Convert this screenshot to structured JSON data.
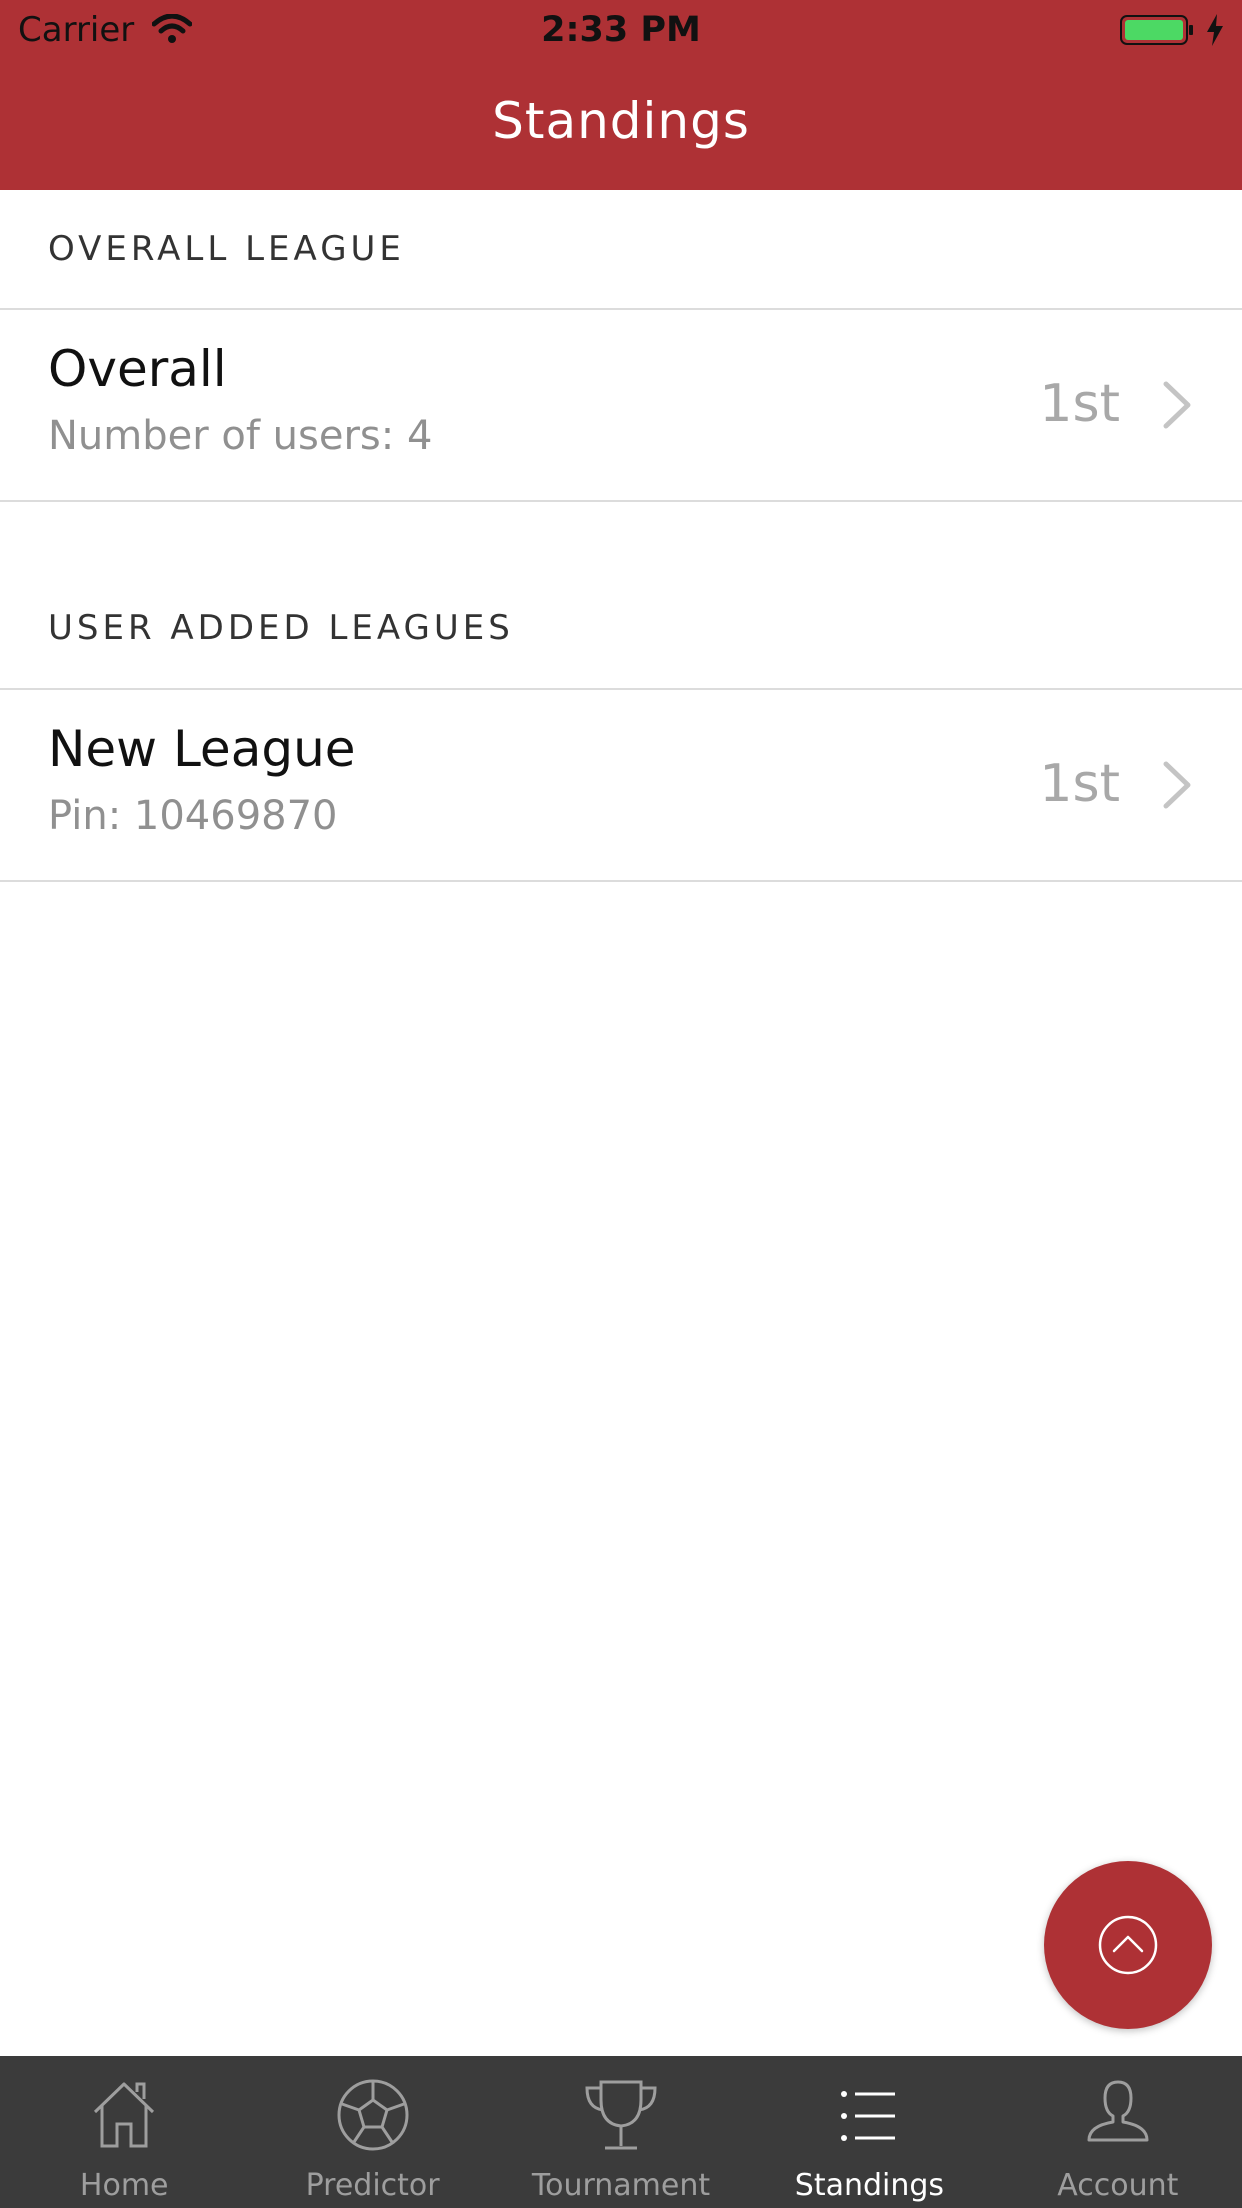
{
  "status_bar": {
    "carrier": "Carrier",
    "time": "2:33 PM"
  },
  "header": {
    "title": "Standings"
  },
  "sections": {
    "overall": {
      "title": "OVERALL LEAGUE",
      "rows": [
        {
          "name": "Overall",
          "subtitle": "Number of users: 4",
          "rank": "1st"
        }
      ]
    },
    "user_added": {
      "title": "USER ADDED LEAGUES",
      "rows": [
        {
          "name": "New League",
          "subtitle": "Pin: 10469870",
          "rank": "1st"
        }
      ]
    }
  },
  "fab": {
    "icon": "chevron-up-circle-icon"
  },
  "tabbar": {
    "tabs": [
      {
        "label": "Home",
        "icon": "home-icon",
        "active": false
      },
      {
        "label": "Predictor",
        "icon": "soccer-ball-icon",
        "active": false
      },
      {
        "label": "Tournament",
        "icon": "trophy-icon",
        "active": false
      },
      {
        "label": "Standings",
        "icon": "list-icon",
        "active": true
      },
      {
        "label": "Account",
        "icon": "user-icon",
        "active": false
      }
    ]
  },
  "colors": {
    "accent": "#ae3135",
    "tabbar_bg": "#3b3b3b",
    "battery": "#4cd964"
  }
}
